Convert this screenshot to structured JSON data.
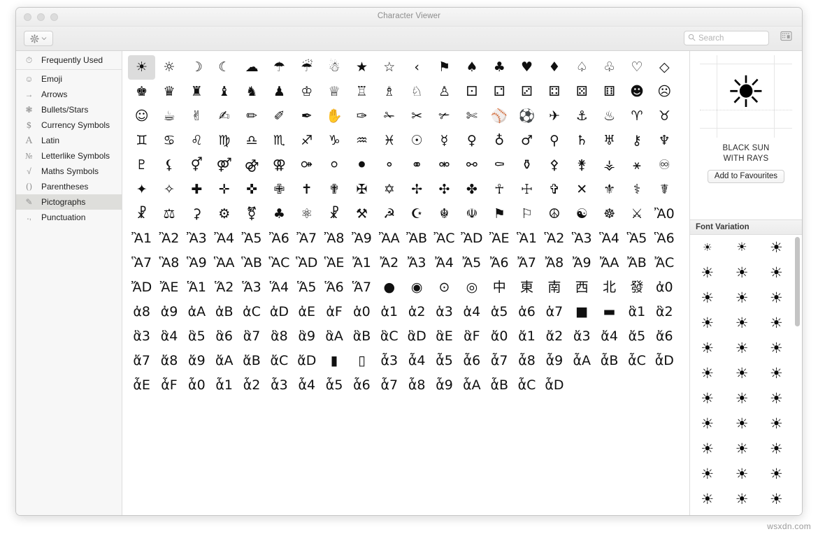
{
  "window": {
    "title": "Character Viewer",
    "traffic_lights": [
      "close",
      "minimize",
      "zoom"
    ]
  },
  "toolbar": {
    "gear_label": "action-menu",
    "search_placeholder": "Search",
    "search_value": "",
    "keyboard_view_label": "keyboard-view"
  },
  "sidebar": {
    "items": [
      {
        "label": "Frequently Used",
        "icon": "clock-icon",
        "glyph": "◴",
        "selected": false
      },
      {
        "label": "Emoji",
        "icon": "smiley-icon",
        "glyph": "☺",
        "selected": false
      },
      {
        "label": "Arrows",
        "icon": "arrow-icon",
        "glyph": "→",
        "selected": false
      },
      {
        "label": "Bullets/Stars",
        "icon": "starburst-icon",
        "glyph": "✳",
        "selected": false
      },
      {
        "label": "Currency Symbols",
        "icon": "dollar-icon",
        "glyph": "$",
        "selected": false
      },
      {
        "label": "Latin",
        "icon": "letter-a-icon",
        "glyph": "A",
        "selected": false
      },
      {
        "label": "Letterlike Symbols",
        "icon": "numero-icon",
        "glyph": "№",
        "selected": false
      },
      {
        "label": "Maths Symbols",
        "icon": "radical-icon",
        "glyph": "√",
        "selected": false
      },
      {
        "label": "Parentheses",
        "icon": "parentheses-icon",
        "glyph": "()",
        "selected": false
      },
      {
        "label": "Pictographs",
        "icon": "pictograph-icon",
        "glyph": "✎",
        "selected": true
      },
      {
        "label": "Punctuation",
        "icon": "punctuation-icon",
        "glyph": "·,",
        "selected": false
      }
    ]
  },
  "detail": {
    "selected_glyph": "☀",
    "glyph_name": "BLACK SUN\nWITH RAYS",
    "add_favourites_label": "Add to Favourites",
    "variation_header": "Font Variation",
    "variations": [
      "☀",
      "☀",
      "☀",
      "☀",
      "☀",
      "☀",
      "☀",
      "☀",
      "☀",
      "☀",
      "☀",
      "☀",
      "☀",
      "☀",
      "☀",
      "☀",
      "☀",
      "☀",
      "☀",
      "☀",
      "☀",
      "☀",
      "☀",
      "☀",
      "☀",
      "☀",
      "☀",
      "☀",
      "☀",
      "☀",
      "☀",
      "☀",
      "☀"
    ]
  },
  "grid": {
    "columns": 20,
    "selected_index": 0,
    "glyphs": [
      "☀",
      "☼",
      "☽",
      "☾",
      "☁",
      "☂",
      "☔",
      "☃",
      "★",
      "☆",
      "‹",
      "⚑",
      "♠",
      "♣",
      "♥",
      "♦",
      "♤",
      "♧",
      "♡",
      "◇",
      "♚",
      "♛",
      "♜",
      "♝",
      "♞",
      "♟",
      "♔",
      "♕",
      "♖",
      "♗",
      "♘",
      "♙",
      "⚀",
      "⚁",
      "⚂",
      "⚃",
      "⚄",
      "⚅",
      "☻",
      "☹",
      "☺",
      "☕",
      "✌",
      "✍",
      "✏",
      "✐",
      "✒",
      "✋",
      "✑",
      "✁",
      "✂",
      "✃",
      "✄",
      "⚾",
      "⚽",
      "✈",
      "⚓",
      "♨",
      "♈",
      "♉",
      "♊",
      "♋",
      "♌",
      "♍",
      "♎",
      "♏",
      "♐",
      "♑",
      "♒",
      "♓",
      "☉",
      "☿",
      "♀",
      "♁",
      "♂",
      "⚲",
      "♄",
      "♅",
      "⚷",
      "♆",
      "♇",
      "⚸",
      "⚥",
      "⚤",
      "⚣",
      "⚢",
      "⚩",
      "⚪",
      "⚫",
      "⚬",
      "⚭",
      "⚮",
      "⚯",
      "⚰",
      "⚱",
      "⚴",
      "⚵",
      "⚶",
      "⚹",
      "♾",
      "✦",
      "✧",
      "✚",
      "✛",
      "✜",
      "✙",
      "✝",
      "✟",
      "✠",
      "✡",
      "✢",
      "✣",
      "✤",
      "☥",
      "☩",
      "✞",
      "✕",
      "⚜",
      "⚕",
      "☤",
      "☧",
      "⚖",
      "⚳",
      "⚙",
      "⚧",
      "♣",
      "⚛",
      "☧",
      "⚒",
      "☭",
      "☪",
      "☬",
      "☫",
      "⚑",
      "⚐",
      "☮",
      "☯",
      "☸",
      "⚔",
      "Ἂ0",
      "Ἂ1",
      "Ἂ2",
      "Ἂ3",
      "Ἂ4",
      "Ἂ5",
      "Ἂ6",
      "Ἂ7",
      "Ἂ8",
      "Ἂ9",
      "ἊA",
      "ἊB",
      "ἊC",
      "ἊD",
      "ἊE",
      "Ἃ1",
      "Ἃ2",
      "Ἃ3",
      "Ἃ4",
      "Ἃ5",
      "Ἃ6",
      "Ἃ7",
      "Ἃ8",
      "Ἃ9",
      "ἋA",
      "ἋB",
      "ἋC",
      "ἋD",
      "ἋE",
      "Ἄ1",
      "Ἄ2",
      "Ἄ3",
      "Ἄ4",
      "Ἄ5",
      "Ἄ6",
      "Ἄ7",
      "Ἄ8",
      "Ἄ9",
      "ἌA",
      "ἌB",
      "ἌC",
      "ἌD",
      "ἌE",
      "Ἅ1",
      "Ἅ2",
      "Ἅ3",
      "Ἅ4",
      "Ἅ5",
      "Ἅ6",
      "Ἅ7",
      "●",
      "◉",
      "⊙",
      "◎",
      "中",
      "東",
      "南",
      "西",
      "北",
      "發",
      "ἀ0",
      "ἀ8",
      "ἀ9",
      "ἀA",
      "ἀB",
      "ἀC",
      "ἀD",
      "ἀE",
      "ἀF",
      "ἁ0",
      "ἁ1",
      "ἁ2",
      "ἁ3",
      "ἁ4",
      "ἁ5",
      "ἁ6",
      "ἁ7",
      "■",
      "▬",
      "ἃ1",
      "ἃ2",
      "ἃ3",
      "ἃ4",
      "ἃ5",
      "ἃ6",
      "ἃ7",
      "ἃ8",
      "ἃ9",
      "ἃA",
      "ἃB",
      "ἃC",
      "ἃD",
      "ἃE",
      "ἃF",
      "ἄ0",
      "ἄ1",
      "ἄ2",
      "ἄ3",
      "ἄ4",
      "ἄ5",
      "ἄ6",
      "ἄ7",
      "ἄ8",
      "ἄ9",
      "ἄA",
      "ἄB",
      "ἄC",
      "ἄD",
      "▮",
      "▯",
      "ἆ3",
      "ἆ4",
      "ἆ5",
      "ἆ6",
      "ἆ7",
      "ἆ8",
      "ἆ9",
      "ἆA",
      "ἆB",
      "ἆC",
      "ἆD",
      "ἆE",
      "ἆF",
      "ἇ0",
      "ἇ1",
      "ἇ2",
      "ἇ3",
      "ἇ4",
      "ἇ5",
      "ἇ6",
      "ἇ7",
      "ἇ8",
      "ἇ9",
      "ἇA",
      "ἇB",
      "ἇC",
      "ἇD"
    ]
  },
  "watermark": "wsxdn.com",
  "colors": {
    "selection": "#dcdcdc",
    "sidebar_selection": "#dededb",
    "window_bg": "#ffffff",
    "sidebar_bg": "#f7f7f7",
    "titlebar_bg": "#f0f0f0"
  }
}
